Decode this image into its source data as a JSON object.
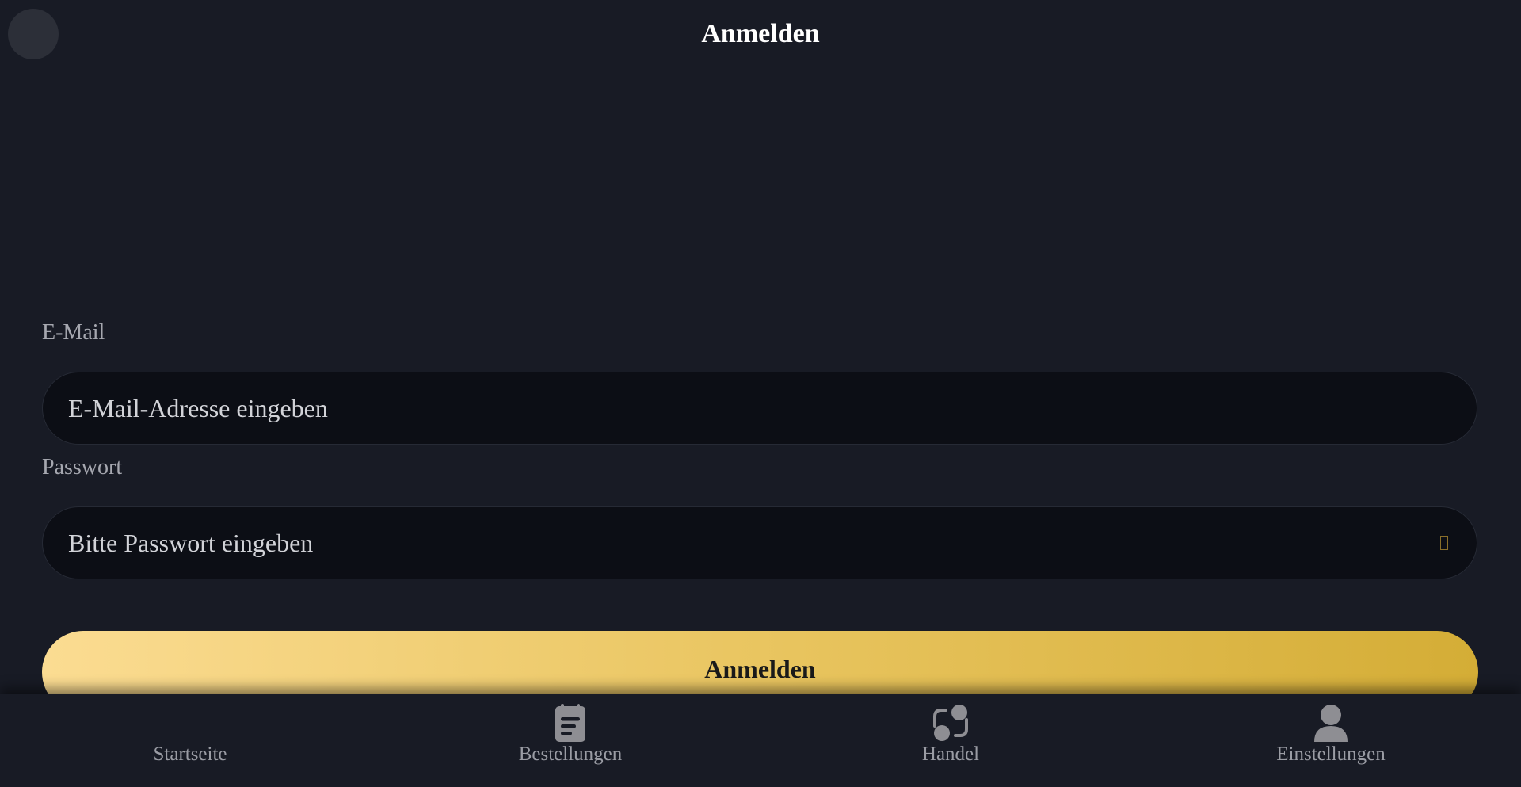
{
  "header": {
    "title": "Anmelden"
  },
  "form": {
    "email_label": "E-Mail",
    "email_placeholder": "E-Mail-Adresse eingeben",
    "password_label": "Passwort",
    "password_placeholder": "Bitte Passwort eingeben",
    "submit_label": "Anmelden"
  },
  "nav": {
    "items": [
      {
        "label": "Startseite",
        "icon": "home-icon"
      },
      {
        "label": "Bestellungen",
        "icon": "clipboard-icon"
      },
      {
        "label": "Handel",
        "icon": "exchange-icon"
      },
      {
        "label": "Einstellungen",
        "icon": "user-icon"
      }
    ]
  },
  "colors": {
    "background": "#181b25",
    "input_background": "#0c0e15",
    "button_gradient_start": "#fbdc92",
    "button_gradient_end": "#d4ad36",
    "nav_icon": "#8e8e93"
  }
}
